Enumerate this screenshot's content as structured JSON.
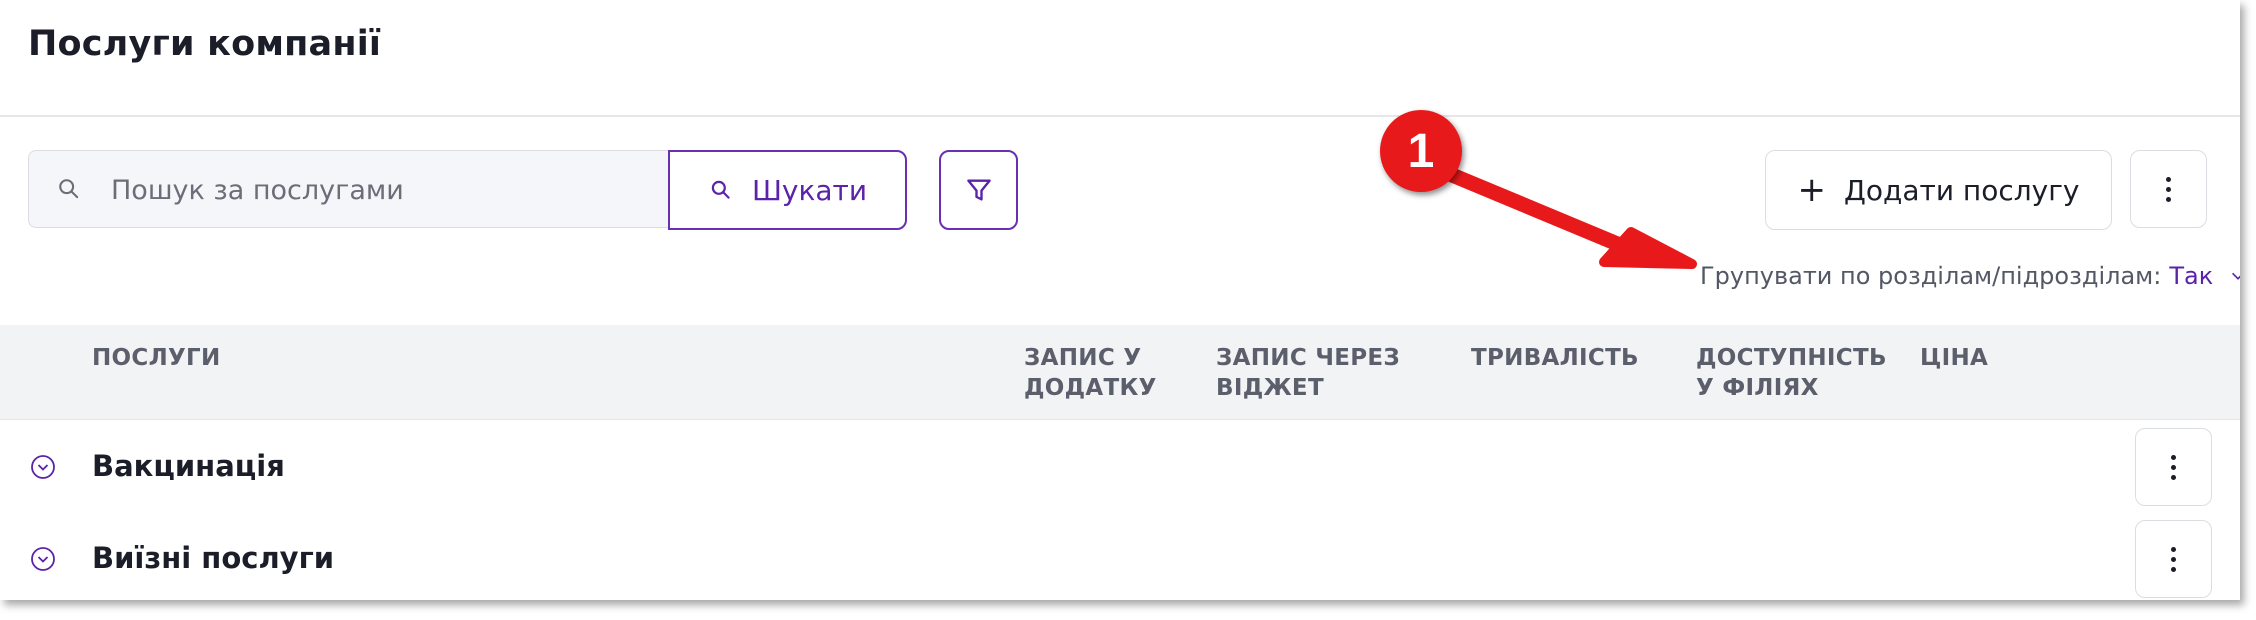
{
  "page": {
    "title": "Послуги компанії"
  },
  "search": {
    "placeholder": "Пошук за послугами",
    "value": "",
    "button_label": "Шукати"
  },
  "toolbar": {
    "filter_icon": "filter-icon",
    "add_label": "Додати послугу",
    "more_icon": "kebab-icon"
  },
  "grouping": {
    "label": "Групувати по розділам/підрозділам:",
    "value": "Так"
  },
  "table": {
    "columns": [
      {
        "line1": "ПОСЛУГИ",
        "line2": ""
      },
      {
        "line1": "ЗАПИС У",
        "line2": "ДОДАТКУ"
      },
      {
        "line1": "ЗАПИС ЧЕРЕЗ",
        "line2": "ВІДЖЕТ"
      },
      {
        "line1": "ТРИВАЛІСТЬ",
        "line2": ""
      },
      {
        "line1": "ДОСТУПНІСТЬ",
        "line2": "У ФІЛІЯХ"
      },
      {
        "line1": "ЦІНА",
        "line2": ""
      }
    ],
    "rows": [
      {
        "name": "Вакцинація"
      },
      {
        "name": "Виїзні послуги"
      }
    ]
  },
  "annotation": {
    "badge": "1"
  },
  "colors": {
    "accent": "#5a23a8",
    "annotation_red": "#e8191b",
    "header_bg": "#f2f3f5"
  }
}
